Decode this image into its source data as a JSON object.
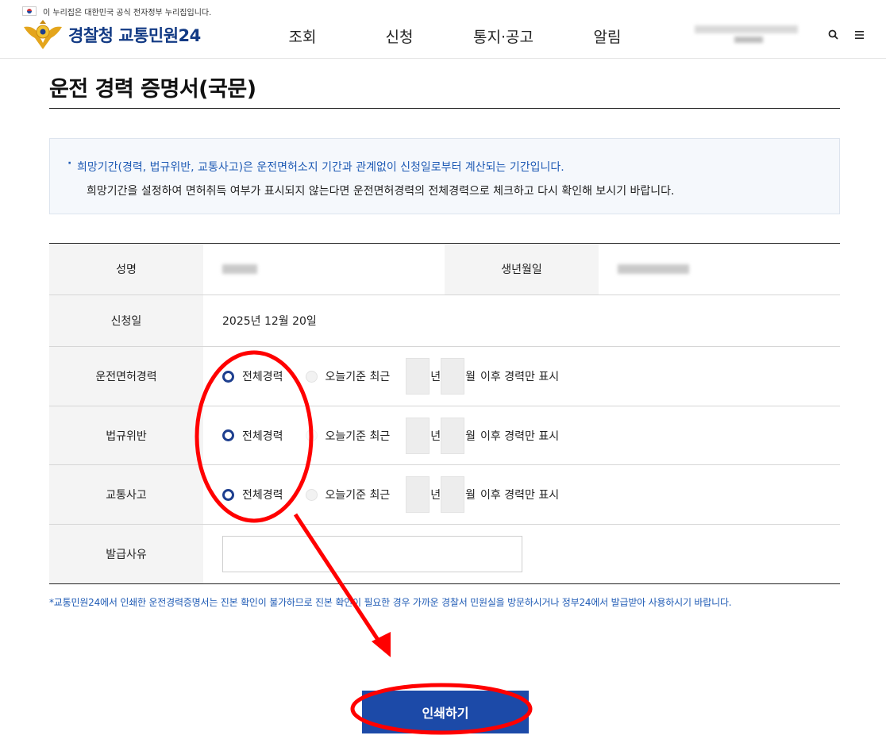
{
  "gov_banner": {
    "text": "이 누리집은 대한민국 공식 전자정부 누리집입니다."
  },
  "header": {
    "logo_text": "경찰청 교통민원24",
    "nav": [
      "조회",
      "신청",
      "통지·공고",
      "알림"
    ]
  },
  "page": {
    "title": "운전 경력 증명서(국문)"
  },
  "notice": {
    "line1": "희망기간(경력, 법규위반, 교통사고)은 운전면허소지 기간과 관계없이 신청일로부터 계산되는 기간입니다.",
    "line2": "희망기간을 설정하여 면허취득 여부가 표시되지 않는다면 운전면허경력의 전체경력으로 체크하고 다시 확인해 보시기 바랍니다."
  },
  "form": {
    "name_label": "성명",
    "birth_label": "생년월일",
    "apply_date_label": "신청일",
    "apply_date_value": "2025년 12월 20일",
    "option_all": "전체경력",
    "option_recent": "오늘기준 최근",
    "unit_year": "년",
    "unit_month": "월",
    "suffix": "이후 경력만 표시",
    "rows": [
      {
        "label": "운전면허경력"
      },
      {
        "label": "법규위반"
      },
      {
        "label": "교통사고"
      }
    ],
    "reason_label": "발급사유",
    "reason_value": ""
  },
  "footnote": "*교통민원24에서 인쇄한 운전경력증명서는 진본 확인이 불가하므로 진본 확인이 필요한 경우 가까운 경찰서 민원실을 방문하시거나 정부24에서 발급받아 사용하시기 바랍니다.",
  "print_button": "인쇄하기",
  "colors": {
    "brand_blue": "#1c4aa8",
    "notice_blue": "#1f5bb5",
    "annotation_red": "#ff0000"
  }
}
